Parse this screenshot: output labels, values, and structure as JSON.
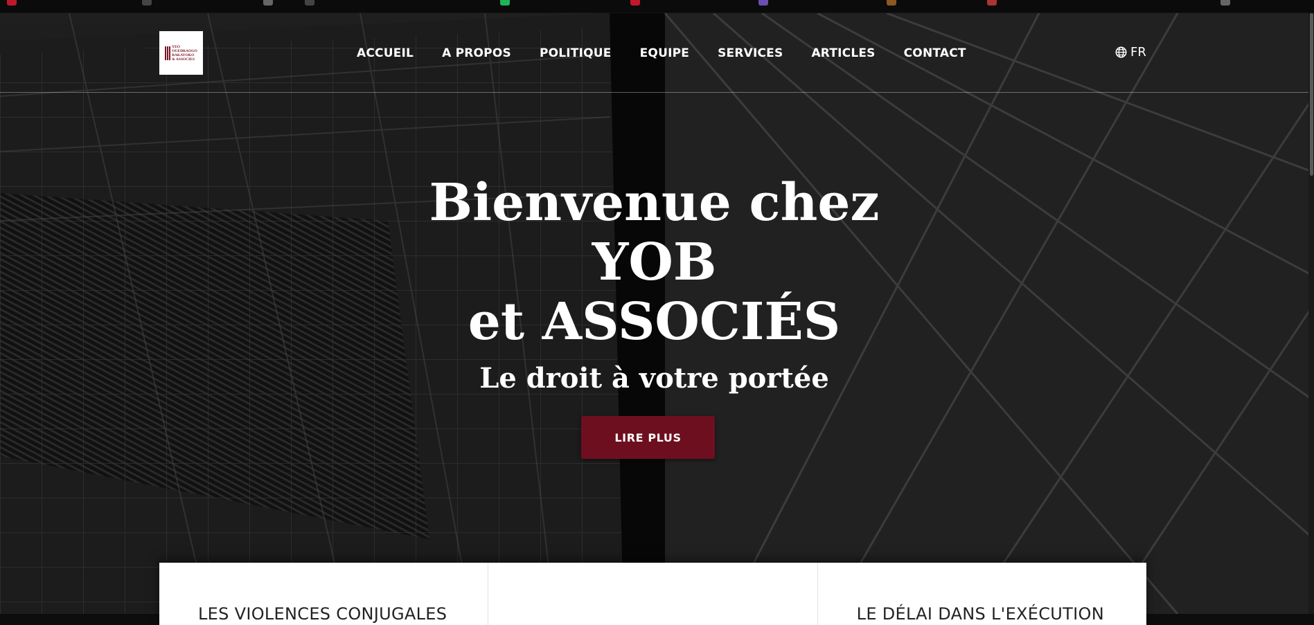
{
  "nav": {
    "items": [
      {
        "label": "ACCUEIL"
      },
      {
        "label": "A PROPOS"
      },
      {
        "label": "POLITIQUE"
      },
      {
        "label": "EQUIPE"
      },
      {
        "label": "SERVICES"
      },
      {
        "label": "ARTICLES"
      },
      {
        "label": "CONTACT"
      }
    ],
    "language": "FR"
  },
  "logo": {
    "text": "YEO\nOUEDRAOGO\nBAKAYOKO\n& ASSOCIES"
  },
  "hero": {
    "title_line1": "Bienvenue chez",
    "title_line2": "YOB",
    "title_line3": "et ASSOCIÉS",
    "subtitle": "Le droit à votre portée",
    "button_label": "LIRE PLUS"
  },
  "cards": [
    {
      "title": "LES VIOLENCES CONJUGALES"
    },
    {
      "title": ""
    },
    {
      "title": "LE DÉLAI DANS L'EXÉCUTION"
    }
  ],
  "colors": {
    "accent": "#6e0f1f",
    "text": "#ffffff"
  }
}
